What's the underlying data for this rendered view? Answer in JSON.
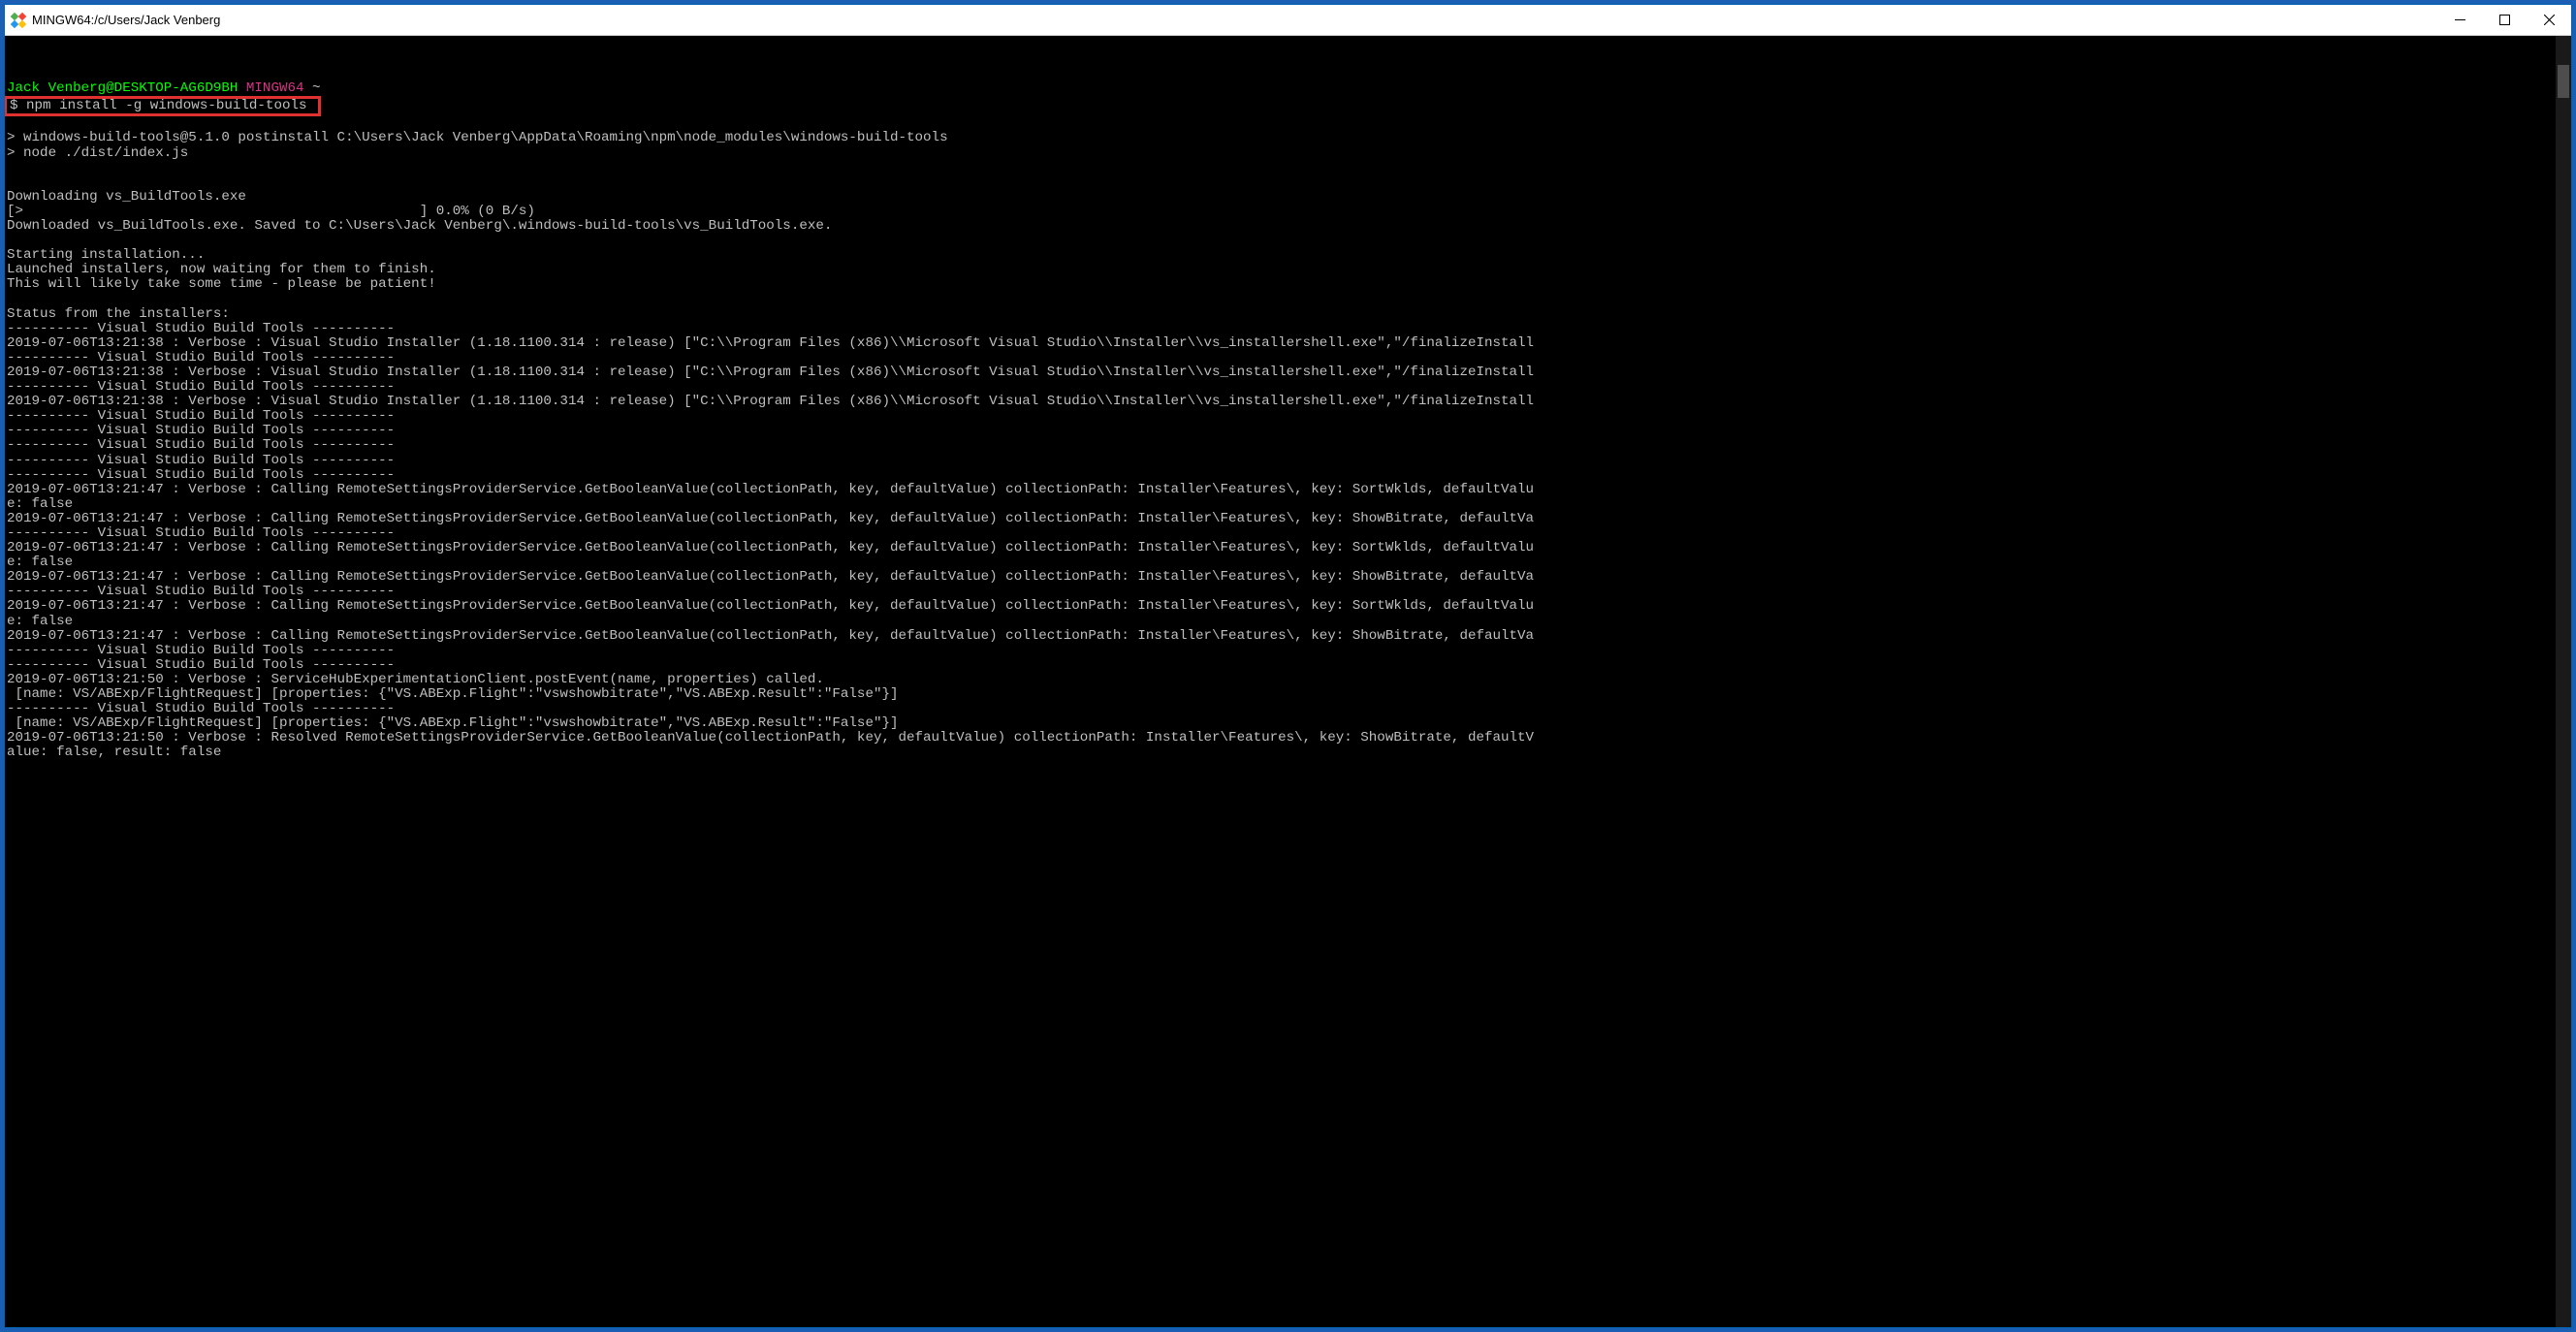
{
  "window": {
    "title": "MINGW64:/c/Users/Jack Venberg"
  },
  "prompt": {
    "user_host": "Jack Venberg@DESKTOP-AG6D9BH",
    "env": "MINGW64",
    "path": "~",
    "dollar": "$",
    "command": "npm install -g windows-build-tools"
  },
  "postinstall": {
    "line1": "> windows-build-tools@5.1.0 postinstall C:\\Users\\Jack Venberg\\AppData\\Roaming\\npm\\node_modules\\windows-build-tools",
    "line2": "> node ./dist/index.js"
  },
  "download": {
    "downloading": "Downloading vs_BuildTools.exe",
    "progress": "[>                                                ] 0.0% (0 B/s)",
    "downloaded": "Downloaded vs_BuildTools.exe. Saved to C:\\Users\\Jack Venberg\\.windows-build-tools\\vs_BuildTools.exe."
  },
  "starting": {
    "l1": "Starting installation...",
    "l2": "Launched installers, now waiting for them to finish.",
    "l3": "This will likely take some time - please be patient!"
  },
  "status_header": "Status from the installers:",
  "sep_pre": "---------- ",
  "sep_label": "Visual Studio Build Tools",
  "sep_post": " ----------",
  "log": {
    "vs_installer": "2019-07-06T13:21:38 : Verbose : Visual Studio Installer (1.18.1100.314 : release) [\"C:\\\\Program Files (x86)\\\\Microsoft Visual Studio\\\\Installer\\\\vs_installershell.exe\",\"/finalizeInstall",
    "sortwklds_a": "2019-07-06T13:21:47 : Verbose : Calling RemoteSettingsProviderService.GetBooleanValue(collectionPath, key, defaultValue) collectionPath: Installer\\Features\\, key: SortWklds, defaultValu",
    "sortwklds_b": "e: false",
    "showbitrate": "2019-07-06T13:21:47 : Verbose : Calling RemoteSettingsProviderService.GetBooleanValue(collectionPath, key, defaultValue) collectionPath: Installer\\Features\\, key: ShowBitrate, defaultVa",
    "postevent": "2019-07-06T13:21:50 : Verbose : ServiceHubExperimentationClient.postEvent(name, properties) called.",
    "flight": " [name: VS/ABExp/FlightRequest] [properties: {\"VS.ABExp.Flight\":\"vswshowbitrate\",\"VS.ABExp.Result\":\"False\"}]",
    "resolved_a": "2019-07-06T13:21:50 : Verbose : Resolved RemoteSettingsProviderService.GetBooleanValue(collectionPath, key, defaultValue) collectionPath: Installer\\Features\\, key: ShowBitrate, defaultV",
    "resolved_b": "alue: false, result: false"
  }
}
